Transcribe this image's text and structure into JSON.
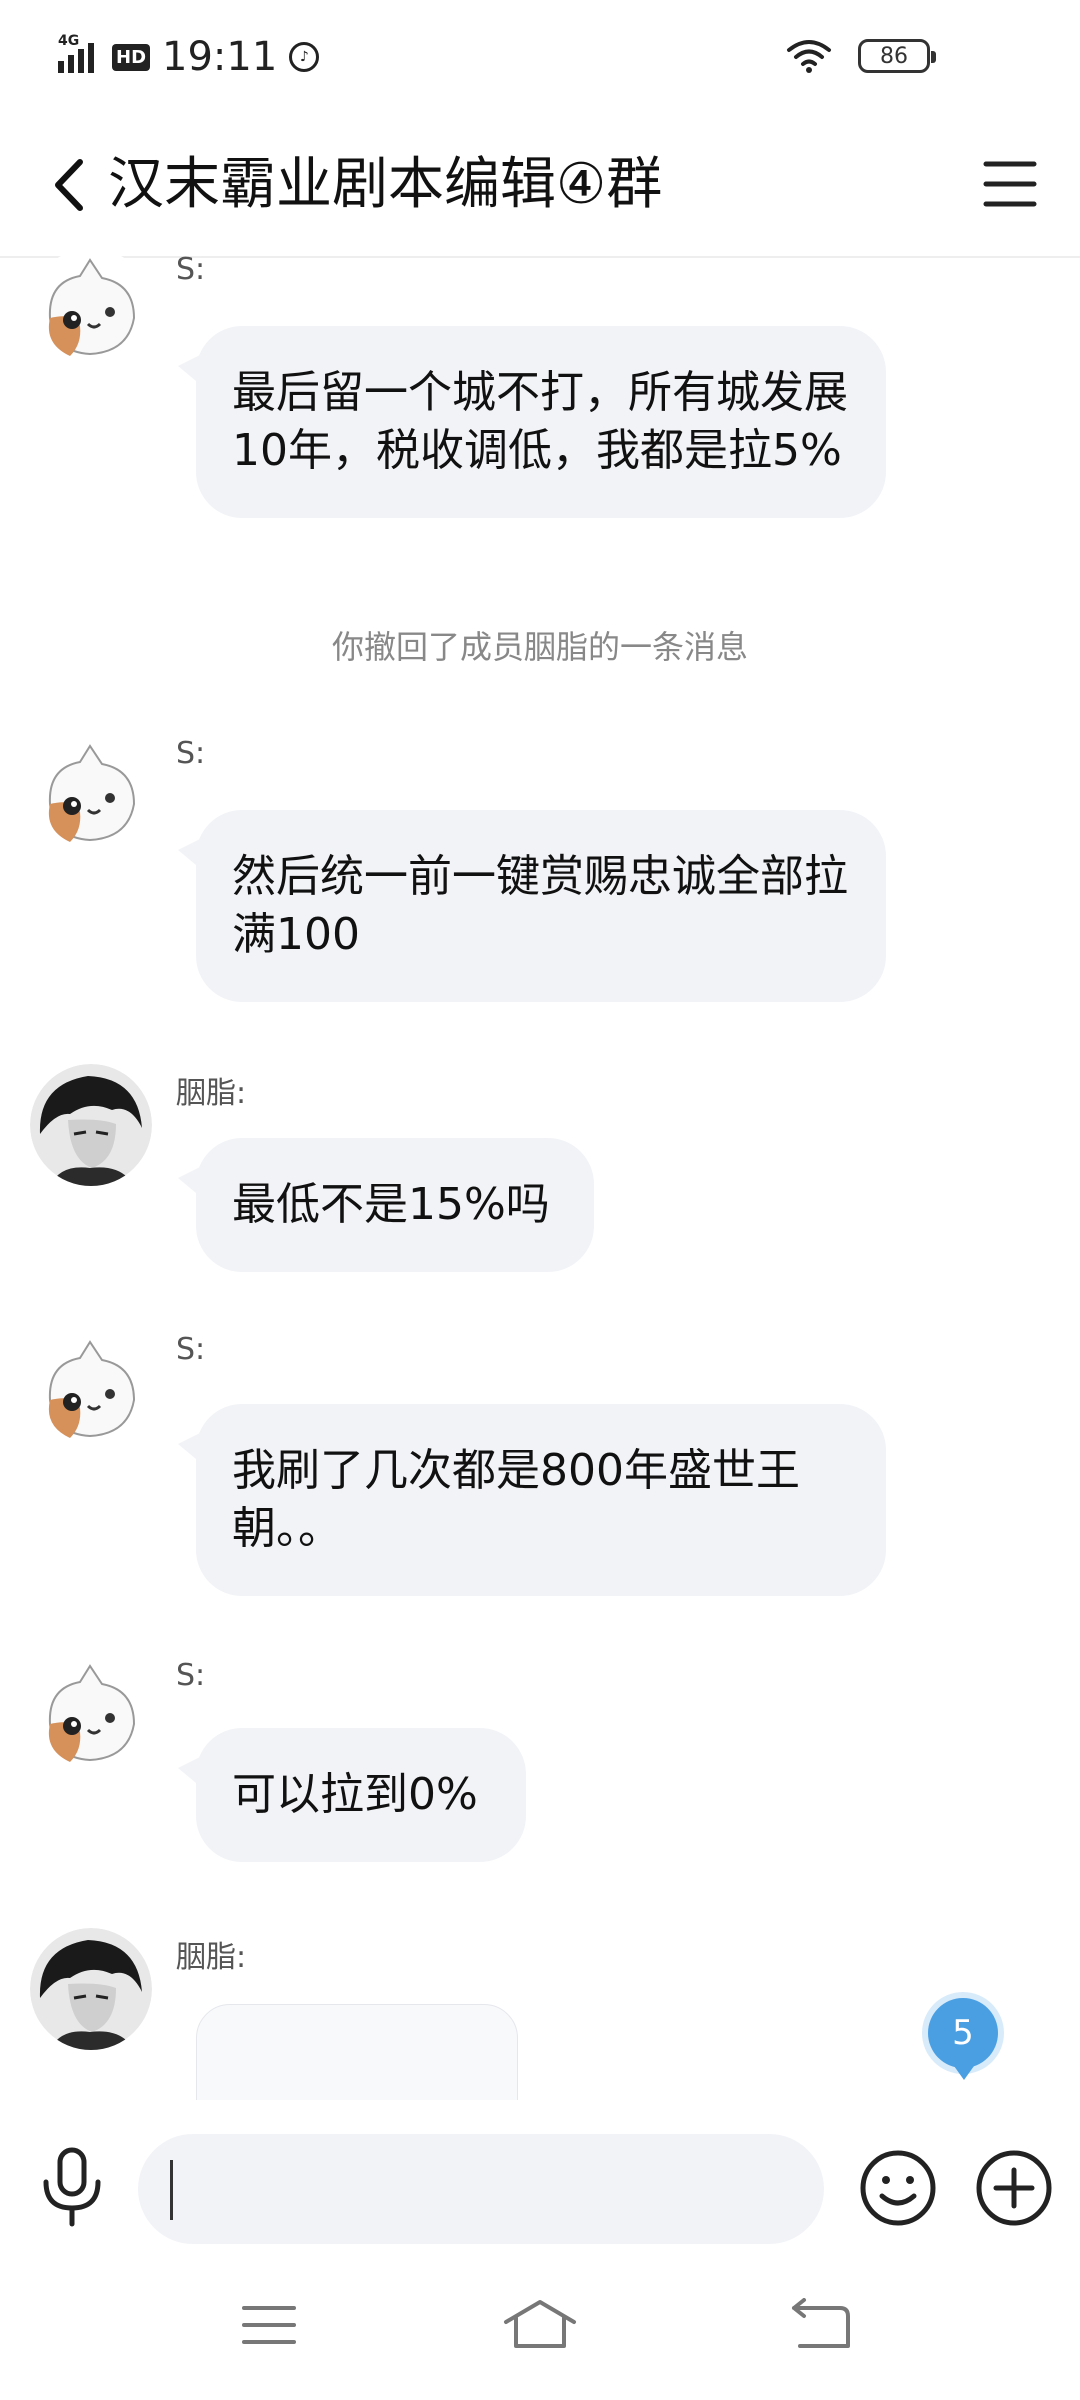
{
  "status_bar": {
    "network": "4G",
    "hd": "HD",
    "time": "19:11",
    "battery": "86"
  },
  "header": {
    "title": "汉末霸业剧本编辑④群",
    "back_icon": "chevron-left-icon",
    "menu_icon": "hamburger-menu-icon"
  },
  "messages": [
    {
      "type": "text",
      "sender": "S:",
      "avatar": "cat-avatar",
      "text": "最后留一个城不打，所有城发展10年，税收调低，我都是拉5%"
    },
    {
      "type": "system",
      "text": "你撤回了成员胭脂的一条消息"
    },
    {
      "type": "text",
      "sender": "S:",
      "avatar": "cat-avatar",
      "text": "然后统一前一键赏赐忠诚全部拉满100"
    },
    {
      "type": "text",
      "sender": "胭脂:",
      "avatar": "anime-avatar",
      "text": "最低不是15%吗"
    },
    {
      "type": "text",
      "sender": "S:",
      "avatar": "cat-avatar",
      "text": "我刷了几次都是800年盛世王朝。。"
    },
    {
      "type": "text",
      "sender": "S:",
      "avatar": "cat-avatar",
      "text": "可以拉到0%"
    },
    {
      "type": "image",
      "sender": "胭脂:",
      "avatar": "anime-avatar"
    }
  ],
  "unread_badge": "5",
  "input": {
    "value": "",
    "icons": [
      "microphone-icon",
      "emoji-icon",
      "plus-icon"
    ]
  },
  "colors": {
    "bubble": "#f2f3f7",
    "badge": "#4a9fe3",
    "system_text": "#888888"
  }
}
